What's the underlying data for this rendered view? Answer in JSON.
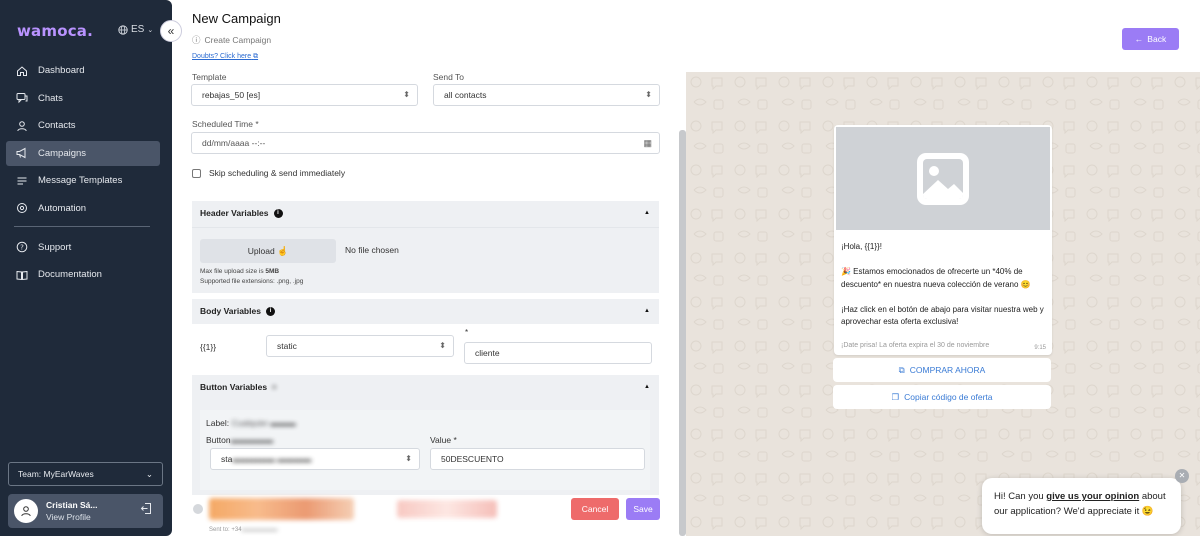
{
  "sidebar": {
    "logo": "wamoca.",
    "language": "ES",
    "items": [
      {
        "label": "Dashboard",
        "icon": "home-icon"
      },
      {
        "label": "Chats",
        "icon": "chat-icon"
      },
      {
        "label": "Contacts",
        "icon": "user-icon"
      },
      {
        "label": "Campaigns",
        "icon": "megaphone-icon",
        "active": true
      },
      {
        "label": "Message Templates",
        "icon": "list-icon"
      },
      {
        "label": "Automation",
        "icon": "automation-icon"
      },
      {
        "label": "Support",
        "icon": "help-icon"
      },
      {
        "label": "Documentation",
        "icon": "book-icon"
      }
    ],
    "team": "Team: MyEarWaves",
    "profile_name": "Cristian Sá...",
    "profile_link": "View Profile"
  },
  "header": {
    "title": "New Campaign",
    "subtitle": "Create Campaign",
    "doubts": "Doubts? Click here",
    "back": "Back"
  },
  "form": {
    "template_label": "Template",
    "template_value": "rebajas_50 [es]",
    "sendto_label": "Send To",
    "sendto_value": "all contacts",
    "scheduled_label": "Scheduled Time *",
    "scheduled_placeholder": "dd/mm/aaaa --:--",
    "skip_label": "Skip scheduling & send immediately",
    "header_vars_title": "Header Variables",
    "upload_label": "Upload",
    "no_file": "No file chosen",
    "max_size_prefix": "Max file upload size is ",
    "max_size": "5MB",
    "extensions": "Supported file extensions: .png, .jpg",
    "body_vars_title": "Body Variables",
    "var1": "{{1}}",
    "var1_type": "static",
    "var1_required": "*",
    "var1_value": "cliente",
    "button_vars_title": "Button Variables",
    "button_label_prefix": "Label: ",
    "button_field_prefix": "Button",
    "button_type_prefix": "sta",
    "value_label": "Value *",
    "value_value": "50DESCUENTO",
    "sent_to_prefix": "Sent to: +34",
    "cancel": "Cancel",
    "save": "Save"
  },
  "preview": {
    "message": "¡Hola, {{1}}!\n\n🎉  Estamos emocionados de ofrecerte un *40% de descuento* en nuestra nueva colección de verano 😊\n\n¡Haz click en el botón de abajo para visitar nuestra web y aprovechar esta oferta exclusiva!",
    "footer": "¡Date prisa! La oferta expira el 30 de noviembre",
    "time": "9:15",
    "button1": "COMPRAR AHORA",
    "button2": "Copiar código de oferta"
  },
  "feedback": {
    "text_before": "Hi! Can you ",
    "link": "give us your opinion",
    "text_after": " about our application? We'd appreciate it 😉"
  }
}
